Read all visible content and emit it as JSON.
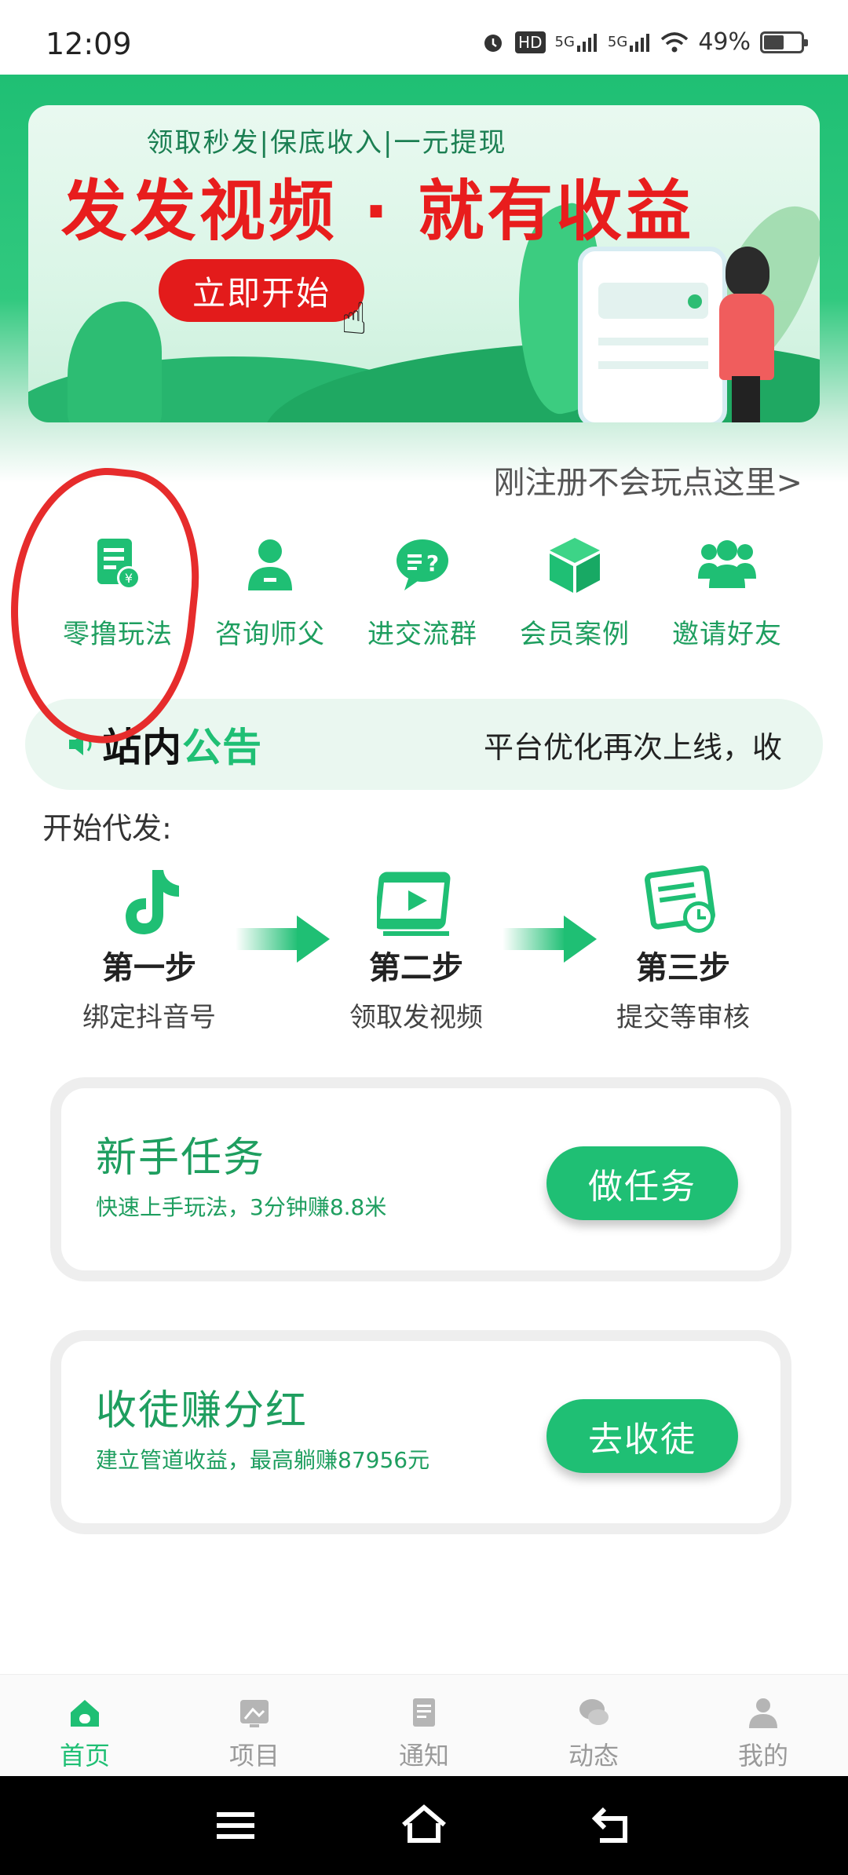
{
  "status_bar": {
    "time": "12:09",
    "hd_label": "HD",
    "signal1_label": "5G",
    "signal2_label": "5G",
    "battery_text": "49%",
    "battery_level": 0.49
  },
  "banner": {
    "subtitle": "领取秒发|保底收入|一元提现",
    "headline": "发发视频 · 就有收益",
    "start_button": "立即开始"
  },
  "help_link": "刚注册不会玩点这里>",
  "quick_icons": [
    {
      "label": "零撸玩法",
      "icon": "document-yuan-icon"
    },
    {
      "label": "咨询师父",
      "icon": "user-icon"
    },
    {
      "label": "进交流群",
      "icon": "chat-question-icon"
    },
    {
      "label": "会员案例",
      "icon": "cube-icon"
    },
    {
      "label": "邀请好友",
      "icon": "group-icon"
    }
  ],
  "notice": {
    "title_part1": "站内",
    "title_part2": "公告",
    "text": "平台优化再次上线，收"
  },
  "steps_section": {
    "label": "开始代发:",
    "steps": [
      {
        "title": "第一步",
        "desc": "绑定抖音号",
        "icon": "tiktok-icon"
      },
      {
        "title": "第二步",
        "desc": "领取发视频",
        "icon": "video-icon"
      },
      {
        "title": "第三步",
        "desc": "提交等审核",
        "icon": "form-clock-icon"
      }
    ]
  },
  "tasks": [
    {
      "title": "新手任务",
      "subtitle": "快速上手玩法，3分钟赚8.8米",
      "button": "做任务"
    },
    {
      "title": "收徒赚分红",
      "subtitle": "建立管道收益，最高躺赚87956元",
      "button": "去收徒"
    }
  ],
  "tabbar": [
    {
      "label": "首页",
      "icon": "home-icon",
      "active": true
    },
    {
      "label": "项目",
      "icon": "project-icon",
      "active": false
    },
    {
      "label": "通知",
      "icon": "notice-icon",
      "active": false
    },
    {
      "label": "动态",
      "icon": "chat-icon",
      "active": false
    },
    {
      "label": "我的",
      "icon": "profile-icon",
      "active": false
    }
  ],
  "colors": {
    "brand_green": "#1fbf74",
    "label_green": "#1e9e5f",
    "banner_red": "#e81d1d",
    "annotation_red": "#e62c2c"
  }
}
